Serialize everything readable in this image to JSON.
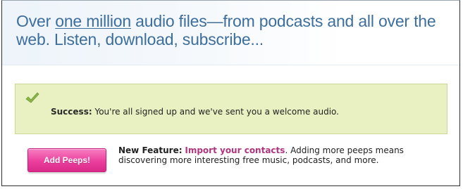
{
  "hero": {
    "lead": "Over ",
    "link": "one million",
    "rest": " audio files—from podcasts and all over the web. Listen, download, subscribe..."
  },
  "success": {
    "icon": "checkmark-icon",
    "label": "Success:",
    "message": " You're all signed up and we've sent you a welcome audio."
  },
  "feature": {
    "button_label": "Add Peeps!",
    "label": "New Feature:",
    "link": "Import your contacts",
    "period": ".",
    "description": " Adding more peeps means discovering more interesting free music, podcasts, and more."
  },
  "colors": {
    "headline": "#3d6e9c",
    "success_bg": "#e9f1c2",
    "button_pink": "#ec3f9d",
    "link_magenta": "#b0357f"
  }
}
